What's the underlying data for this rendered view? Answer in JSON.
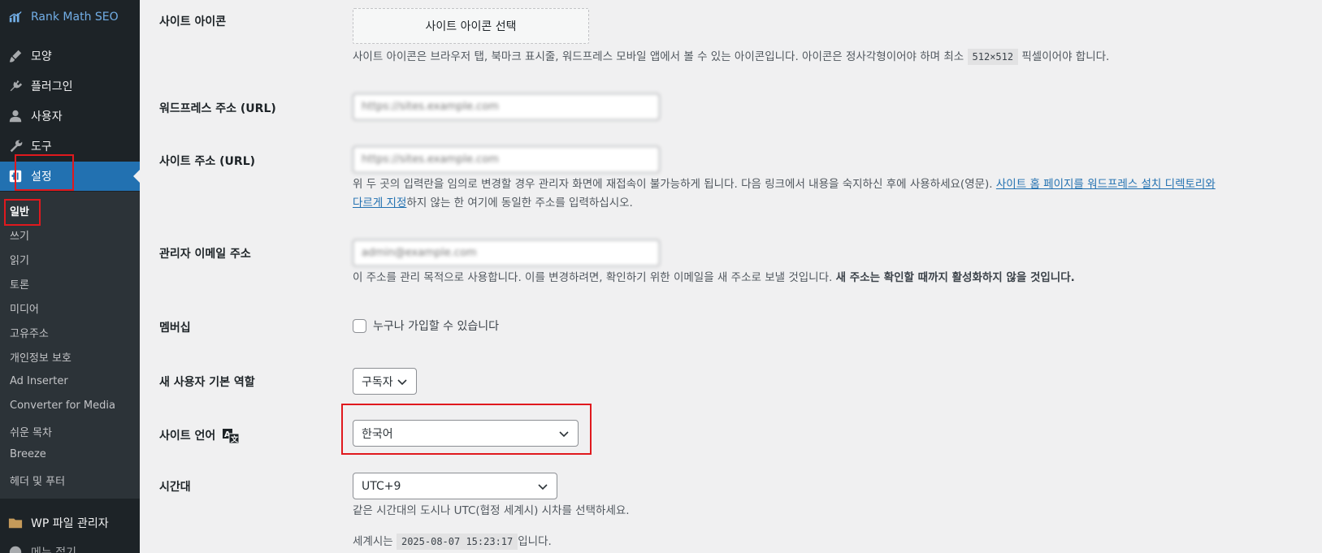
{
  "sidebar": {
    "top_item": {
      "label": "Rank Math SEO",
      "icon": "rankmath-chart-icon"
    },
    "items": [
      {
        "label": "모양",
        "icon": "paintbrush-icon"
      },
      {
        "label": "플러그인",
        "icon": "plugin-icon"
      },
      {
        "label": "사용자",
        "icon": "user-icon"
      },
      {
        "label": "도구",
        "icon": "wrench-icon"
      },
      {
        "label": "설정",
        "icon": "settings-icon"
      }
    ],
    "submenu": [
      "일반",
      "쓰기",
      "읽기",
      "토론",
      "미디어",
      "고유주소",
      "개인정보 보호",
      "Ad Inserter",
      "Converter for Media",
      "쉬운 목차",
      "Breeze",
      "헤더 및 푸터"
    ],
    "bottom_item": {
      "label": "WP 파일 관리자",
      "icon": "folder-icon"
    },
    "cut_item": "메뉴 접기"
  },
  "form": {
    "site_icon": {
      "label": "사이트 아이콘",
      "button": "사이트 아이콘 선택",
      "desc_before": "사이트 아이콘은 브라우저 탭, 북마크 표시줄, 워드프레스 모바일 앱에서 볼 수 있는 아이콘입니다. 아이콘은 정사각형이어야 하며 최소",
      "size_code": "512×512",
      "desc_after": "픽셀이어야 합니다."
    },
    "wp_address": {
      "label": "워드프레스 주소 (URL)",
      "value": "https://sites.example.com"
    },
    "site_address": {
      "label": "사이트 주소 (URL)",
      "value": "https://sites.example.com",
      "desc_before": "위 두 곳의 입력란을 임의로 변경할 경우 관리자 화면에 재접속이 불가능하게 됩니다. 다음 링크에서 내용을 숙지하신 후에 사용하세요(영문).",
      "link_line1": "사이트 홈 페이지를 워드프레스 설치 디렉토리와",
      "link_line2": "다르게 지정",
      "desc_after": "하지 않는 한 여기에 동일한 주소를 입력하십시오."
    },
    "admin_email": {
      "label": "관리자 이메일 주소",
      "value": "admin@example.com",
      "desc": "이 주소를 관리 목적으로 사용합니다. 이를 변경하려면, 확인하기 위한 이메일을 새 주소로 보낼 것입니다.",
      "desc_bold": "새 주소는 확인할 때까지 활성화하지 않을 것입니다."
    },
    "membership": {
      "label": "멤버십",
      "checkbox_label": "누구나 가입할 수 있습니다",
      "checked": false
    },
    "default_role": {
      "label": "새 사용자 기본 역할",
      "value": "구독자"
    },
    "site_language": {
      "label": "사이트 언어",
      "value": "한국어",
      "icon": "translate-icon"
    },
    "timezone": {
      "label": "시간대",
      "value": "UTC+9",
      "desc": "같은 시간대의 도시나 UTC(협정 세계시) 시차를 선택하세요.",
      "universal_before": "세계시는",
      "universal_time": "2025-08-07 15:23:17",
      "universal_after": "입니다."
    }
  },
  "colors": {
    "sidebar_bg": "#1d2327",
    "accent": "#2271b1",
    "highlight_border": "#e0191e"
  }
}
